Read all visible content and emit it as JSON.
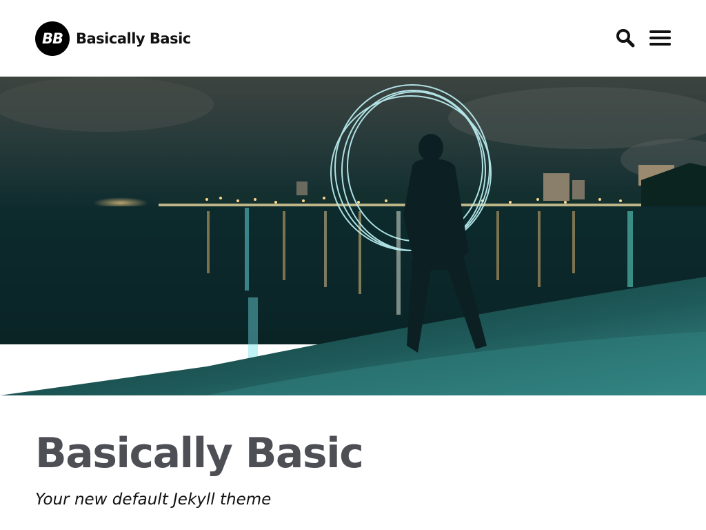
{
  "header": {
    "logo_text": "BB",
    "site_title": "Basically Basic",
    "search_icon": "search-icon",
    "menu_icon": "hamburger-menu-icon"
  },
  "hero": {
    "image": "night-beach-light-painting-photo"
  },
  "page": {
    "title": "Basically Basic",
    "subtitle": "Your new default Jekyll theme"
  },
  "colors": {
    "title": "#4d4f55",
    "logo_bg": "#000000",
    "header_bg": "#ffffff"
  }
}
